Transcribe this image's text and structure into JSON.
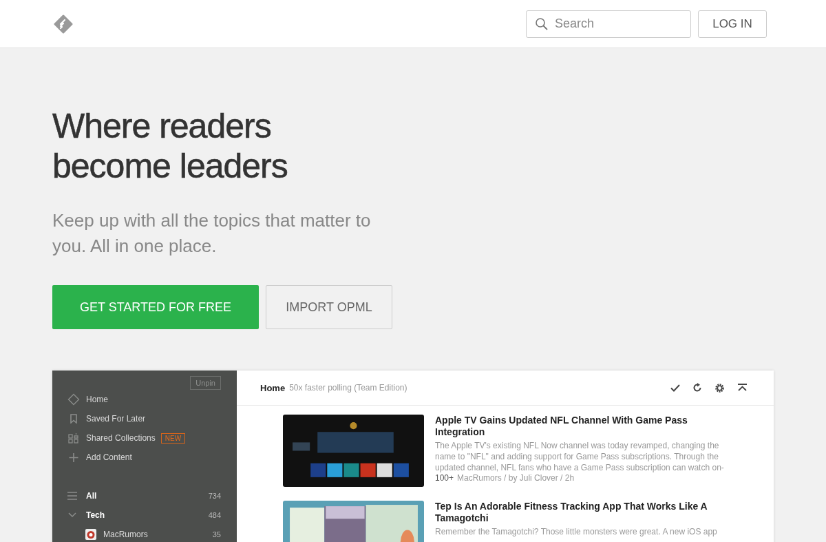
{
  "header": {
    "search": {
      "placeholder": "Search"
    },
    "login": "LOG IN"
  },
  "hero": {
    "title_lines": [
      "Where readers",
      "become leaders"
    ],
    "subtitle": "Keep up with all the topics that matter to you. All in one place.",
    "buttons": [
      {
        "label": "GET STARTED FOR FREE",
        "kind": "primary"
      },
      {
        "label": "IMPORT OPML",
        "kind": "secondary"
      }
    ]
  },
  "app": {
    "sidebar": {
      "unpin": "Unpin",
      "nav": [
        {
          "label": "Home"
        },
        {
          "label": "Saved For Later"
        },
        {
          "label": "Shared Collections",
          "badge": "NEW"
        },
        {
          "label": "Add Content"
        }
      ],
      "feeds": [
        {
          "label": "All",
          "count": "734",
          "kind": "all"
        },
        {
          "label": "Tech",
          "count": "484",
          "kind": "folder",
          "expanded": true
        },
        {
          "label": "MacRumors",
          "count": "35",
          "kind": "source"
        }
      ]
    },
    "toolbar": {
      "title": "Home",
      "subtitle": "50x faster polling (Team Edition)"
    },
    "articles": [
      {
        "title": "Apple TV Gains Updated NFL Channel With Game Pass Integration",
        "summary": "The Apple TV's existing NFL Now channel was today revamped, changing the name to \"NFL\" and adding support for Game Pass subscriptions. Through the updated channel, NFL fans who have a Game Pass subscription can watch on-",
        "count": "100+",
        "meta": "MacRumors / by Juli Clover / 2h"
      },
      {
        "title": "Tep Is An Adorable Fitness Tracking App That Works Like A Tamagotchi",
        "summary": "Remember the Tamagotchi? Those little monsters were great. A new iOS app"
      }
    ]
  }
}
